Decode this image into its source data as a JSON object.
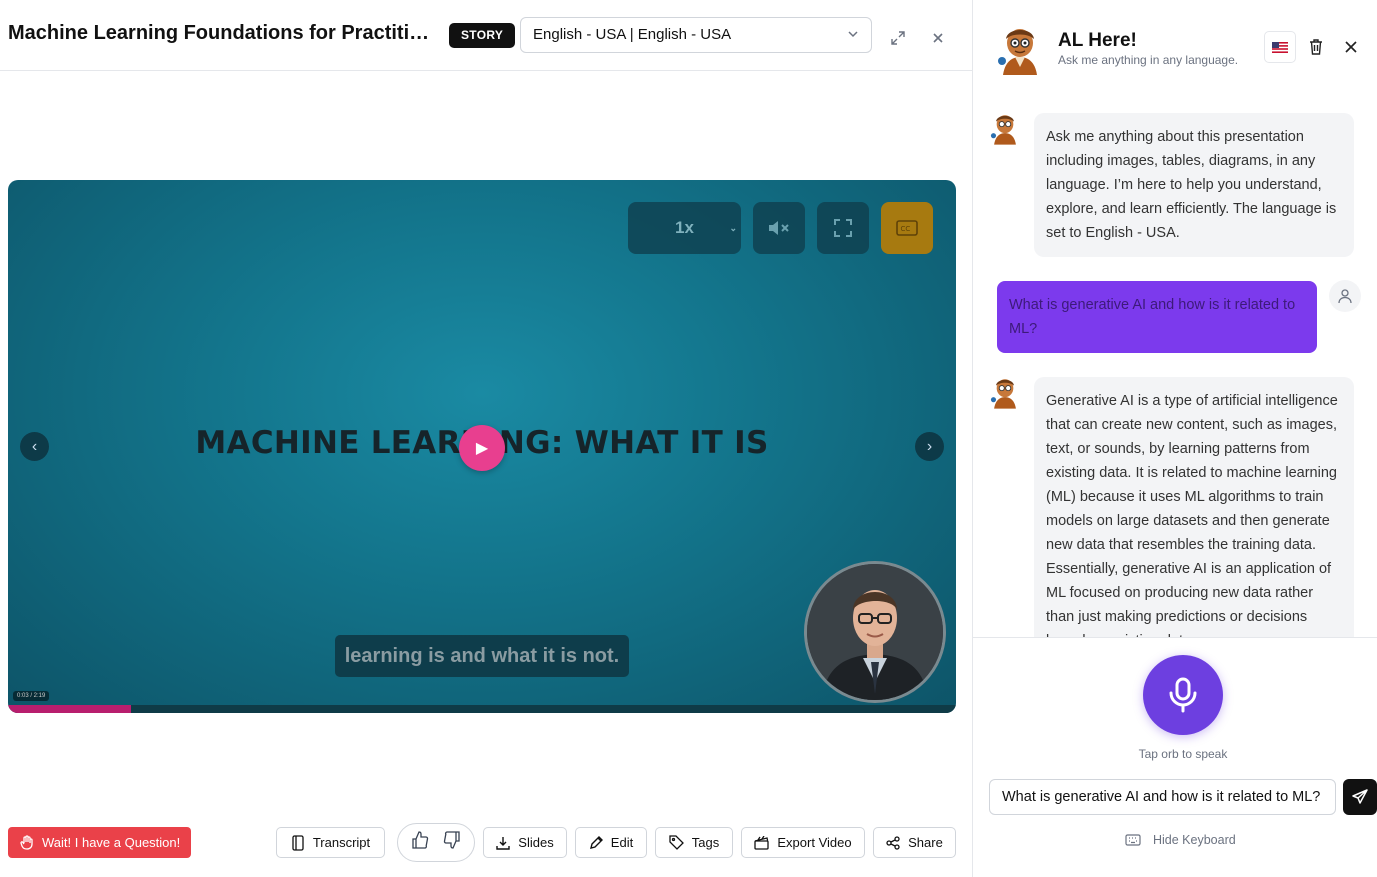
{
  "header": {
    "title": "Machine Learning Foundations for Practition...",
    "badge": "STORY",
    "language": "English - USA | English - USA"
  },
  "video": {
    "speed": "1x",
    "slide_title": "MACHINE LEARNING: WHAT IT IS",
    "caption": "learning is and what it is not.",
    "timestamp": "0:03 / 2:19",
    "progress_fraction": 0.13,
    "prev_label": "‹",
    "next_label": "›"
  },
  "toolbar": {
    "question_label": "Wait! I have a Question!",
    "transcript_label": "Transcript",
    "slides_label": "Slides",
    "edit_label": "Edit",
    "tags_label": "Tags",
    "export_label": "Export Video",
    "share_label": "Share"
  },
  "assistant": {
    "name": "AL Here!",
    "subtitle": "Ask me anything in any language.",
    "messages": [
      {
        "role": "assistant",
        "text": "Ask me anything about this presentation including images, tables, diagrams, in any language. I’m here to help you understand, explore, and learn efficiently. The language is set to English - USA."
      },
      {
        "role": "user",
        "text": "What is generative AI and how is it related to ML?"
      },
      {
        "role": "assistant",
        "text": "Generative AI is a type of artificial intelligence that can create new content, such as images, text, or sounds, by learning patterns from existing data. It is related to machine learning (ML) because it uses ML algorithms to train models on large datasets and then generate new data that resembles the training data. Essentially, generative AI is an application of ML focused on producing new data rather than just making predictions or decisions based on existing data."
      }
    ],
    "tap_label": "Tap orb to speak",
    "input_value": "What is generative AI and how is it related to ML?",
    "hide_keyboard_label": "Hide Keyboard"
  },
  "colors": {
    "accent_purple": "#7c3aed",
    "question_red": "#ea4149",
    "play_pink": "#e83f8f",
    "cc_gold": "#a77a10"
  }
}
